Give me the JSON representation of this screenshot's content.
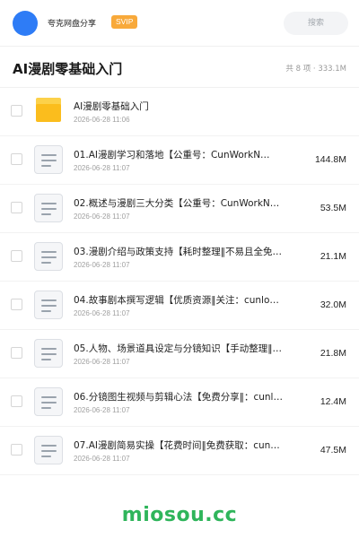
{
  "header": {
    "brand": "夸克网盘分享",
    "badge": "SVIP",
    "search_placeholder": "搜索"
  },
  "folder": {
    "title": "AI漫剧零基础入门",
    "summary": "共 8 项 · 333.1M"
  },
  "items": [
    {
      "type": "folder",
      "icon": "folder-icon",
      "name": "AI漫剧零基础入门",
      "date": "2026-06-28 11:06",
      "size": ""
    },
    {
      "type": "file",
      "icon": "document-icon",
      "name": "01.AI漫剧学习和落地【公重号：CunWorkN…",
      "date": "2026-06-28 11:07",
      "size": "144.8M"
    },
    {
      "type": "file",
      "icon": "document-icon",
      "name": "02.概述与漫剧三大分类【公重号：CunWorkN…",
      "date": "2026-06-28 11:07",
      "size": "53.5M"
    },
    {
      "type": "file",
      "icon": "document-icon",
      "name": "03.漫剧介绍与政策支持【耗时整理‖不易且全免费：…",
      "date": "2026-06-28 11:07",
      "size": "21.1M"
    },
    {
      "type": "file",
      "icon": "document-icon",
      "name": "04.故事剧本撰写逻辑【优质资源‖关注：cunlo…",
      "date": "2026-06-28 11:07",
      "size": "32.0M"
    },
    {
      "type": "file",
      "icon": "document-icon",
      "name": "05.人物、场景道具设定与分镜知识【手动整理‖：c…",
      "date": "2026-06-28 11:07",
      "size": "21.8M"
    },
    {
      "type": "file",
      "icon": "document-icon",
      "name": "06.分镜图生视频与剪辑心法【免费分享‖：cunl…",
      "date": "2026-06-28 11:07",
      "size": "12.4M"
    },
    {
      "type": "file",
      "icon": "document-icon",
      "name": "07.AI漫剧简易实操【花费时间‖免费获取：cun…",
      "date": "2026-06-28 11:07",
      "size": "47.5M"
    }
  ],
  "watermark": "miosou.cc",
  "colors": {
    "avatar": "#2e7cf6",
    "badge": "#f8a93a",
    "folder": "#fbbd1d",
    "watermark": "#2fb55b"
  }
}
